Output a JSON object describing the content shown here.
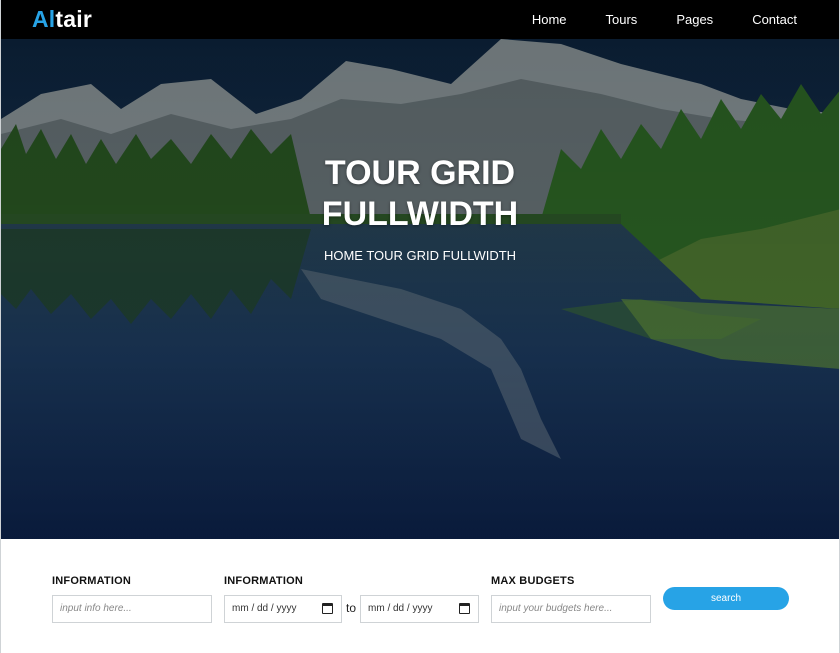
{
  "nav": {
    "logo_accent": "Al",
    "logo_rest": "tair",
    "items": [
      {
        "label": "Home"
      },
      {
        "label": "Tours"
      },
      {
        "label": "Pages"
      },
      {
        "label": "Contact"
      }
    ]
  },
  "hero": {
    "title_line1": "TOUR GRID",
    "title_line2": "FULLWIDTH",
    "breadcrumb": "HOME TOUR GRID FULLWIDTH"
  },
  "search": {
    "info1_label": "INFORMATION",
    "info1_placeholder": "input info here...",
    "info2_label": "INFORMATION",
    "date_from": "mm / dd / yyyy",
    "to_label": "to",
    "date_to": "mm / dd / yyyy",
    "budget_label": "MAX BUDGETS",
    "budget_placeholder": "input your budgets here...",
    "button_label": "search"
  },
  "colors": {
    "accent": "#27a3e6",
    "navbar_bg": "#000000"
  }
}
